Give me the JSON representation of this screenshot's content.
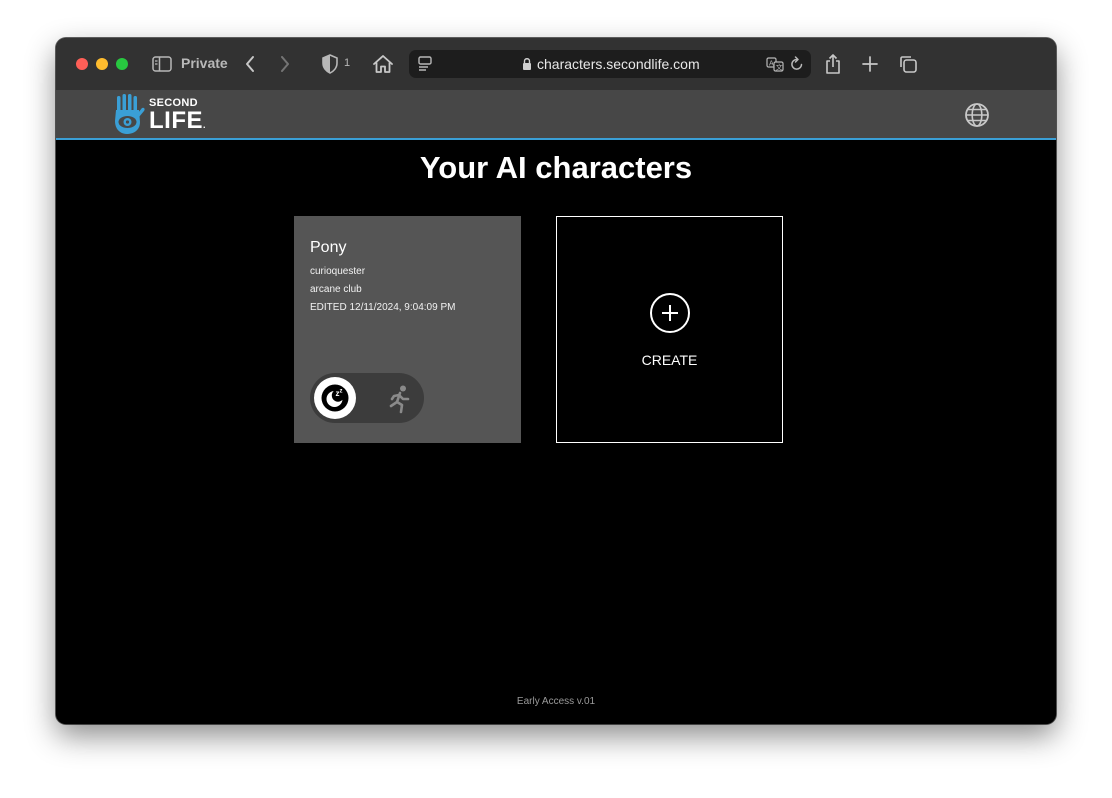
{
  "browser": {
    "mode_label": "Private",
    "shield_count": "1",
    "url": "characters.secondlife.com"
  },
  "site": {
    "logo_second": "SECOND",
    "logo_life": "LIFE",
    "logo_mark": ".",
    "brand_color": "#3a9fd6"
  },
  "main": {
    "title": "Your AI characters",
    "characters": [
      {
        "name": "Pony",
        "owner": "curioquester",
        "location": "arcane club",
        "edited": "EDITED 12/11/2024, 9:04:09 PM",
        "state": "sleep"
      }
    ],
    "create_label": "CREATE"
  },
  "footer": {
    "version": "Early Access v.01"
  }
}
